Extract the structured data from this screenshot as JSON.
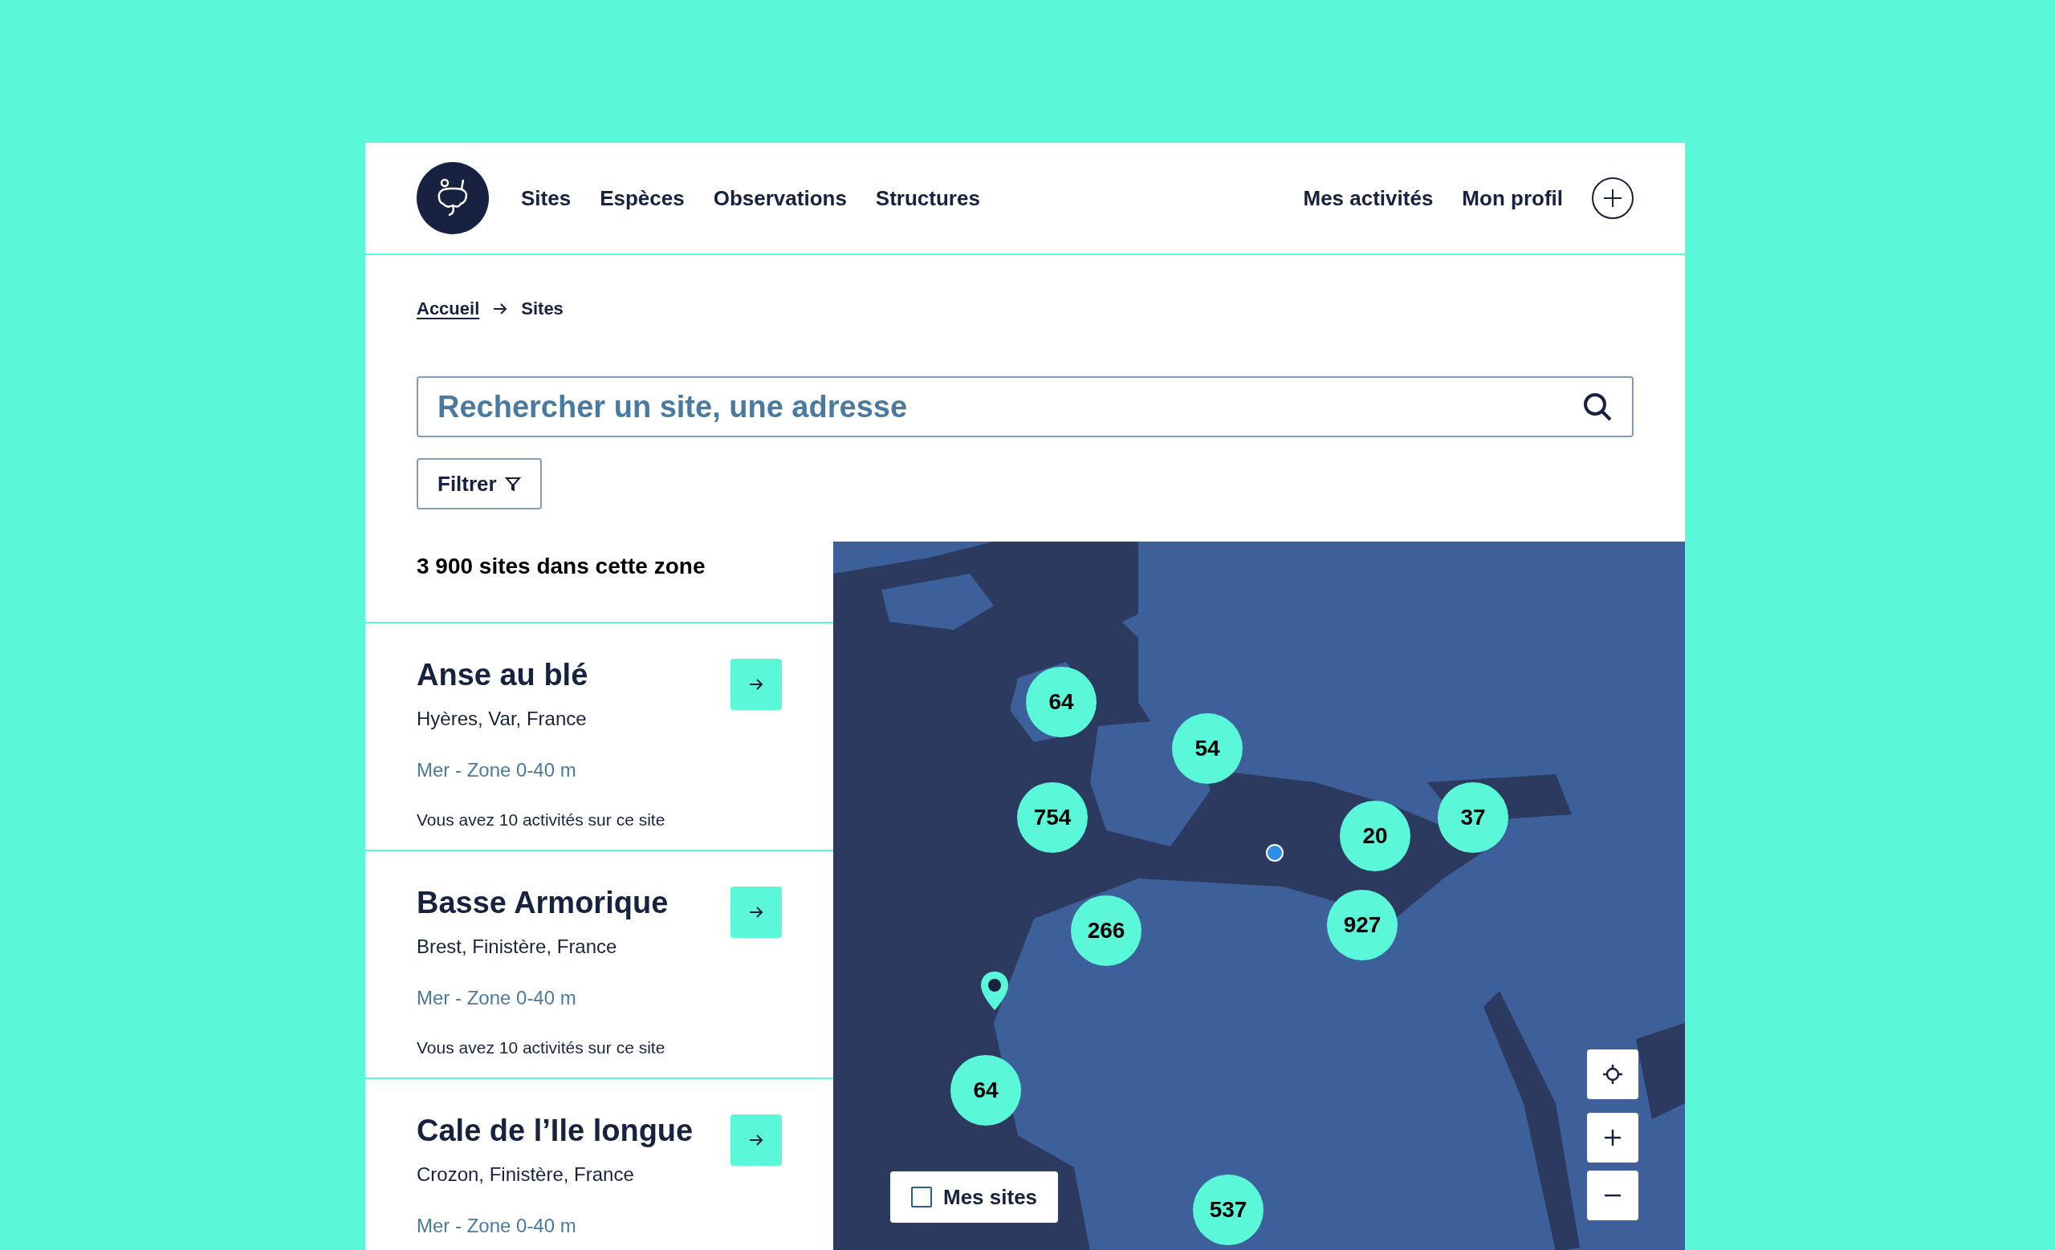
{
  "nav": {
    "items": [
      "Sites",
      "Espèces",
      "Observations",
      "Structures"
    ],
    "right_items": [
      "Mes activités",
      "Mon profil"
    ]
  },
  "breadcrumb": [
    "Accueil",
    "Sites"
  ],
  "search": {
    "placeholder": "Rechercher un site, une adresse"
  },
  "filter_button": "Filtrer",
  "result_count": "3 900 sites dans cette zone",
  "sites": [
    {
      "name": "Anse au blé",
      "location": "Hyères, Var, France",
      "zone": "Mer - Zone 0-40 m",
      "activities": "Vous avez 10 activités sur ce site"
    },
    {
      "name": "Basse Armorique",
      "location": "Brest, Finistère, France",
      "zone": "Mer - Zone 0-40 m",
      "activities": "Vous avez 10 activités sur ce site"
    },
    {
      "name": "Cale de l’Ile longue",
      "location": "Crozon, Finistère, France",
      "zone": "Mer - Zone 0-40 m"
    }
  ],
  "map": {
    "clusters": [
      "64",
      "54",
      "754",
      "20",
      "37",
      "266",
      "927",
      "64",
      "537"
    ],
    "my_sites": {
      "label": "Mes sites",
      "checked": false
    }
  }
}
